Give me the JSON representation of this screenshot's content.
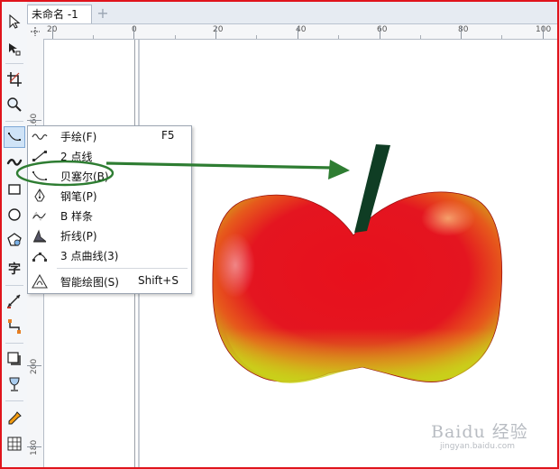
{
  "document_tab": {
    "label": "未命名 -1",
    "add_symbol": "+"
  },
  "ruler_top": {
    "labels": [
      "20",
      "0",
      "20",
      "40",
      "60",
      "80",
      "100"
    ]
  },
  "ruler_left": {
    "labels": [
      "160",
      "200",
      "180"
    ]
  },
  "toolbox": {
    "text_tool_glyph": "字"
  },
  "flyout": {
    "items": [
      {
        "icon": "freehand-icon",
        "label": "手绘(F)",
        "shortcut": "F5"
      },
      {
        "icon": "two-point-line-icon",
        "label": "2 点线",
        "shortcut": ""
      },
      {
        "icon": "bezier-icon",
        "label": "贝塞尔(B)",
        "shortcut": ""
      },
      {
        "icon": "pen-icon",
        "label": "钢笔(P)",
        "shortcut": ""
      },
      {
        "icon": "b-spline-icon",
        "label": "B 样条",
        "shortcut": ""
      },
      {
        "icon": "polyline-icon",
        "label": "折线(P)",
        "shortcut": ""
      },
      {
        "icon": "three-point-curve-icon",
        "label": "3 点曲线(3)",
        "shortcut": ""
      },
      {
        "icon": "smart-drawing-icon",
        "label": "智能绘图(S)",
        "shortcut": "Shift+S"
      }
    ]
  },
  "colors": {
    "frame_border": "#e0141c",
    "highlight_ellipse": "#2e7d32",
    "arrow": "#2e7d32",
    "apple_red": "#e8141c",
    "apple_stem": "#0f3d24"
  },
  "watermark": {
    "brand": "Baidu 经验",
    "url": "jingyan.baidu.com"
  }
}
